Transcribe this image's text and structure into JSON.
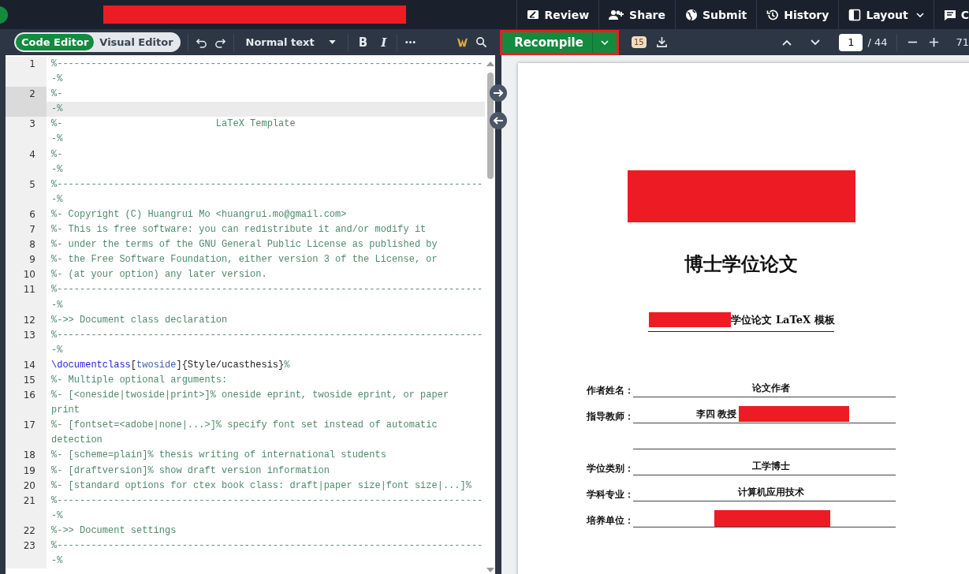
{
  "top_nav": [
    {
      "kind": "review",
      "label": "Review",
      "dropdown": false
    },
    {
      "kind": "share",
      "label": "Share",
      "dropdown": false
    },
    {
      "kind": "submit",
      "label": "Submit",
      "dropdown": false
    },
    {
      "kind": "history",
      "label": "History",
      "dropdown": false
    },
    {
      "kind": "layout",
      "label": "Layout",
      "dropdown": true
    },
    {
      "kind": "chat",
      "label": "C",
      "dropdown": false
    }
  ],
  "editor_modes": [
    {
      "label": "Code Editor",
      "selected": true
    },
    {
      "label": "Visual Editor",
      "selected": false
    }
  ],
  "style_dropdown": "Normal text",
  "format_buttons": [
    {
      "kind": "bold",
      "label": "B"
    },
    {
      "kind": "italic",
      "label": "I"
    }
  ],
  "pdf_toolbar": {
    "recompile": "Recompile",
    "log_badge": "15",
    "page": "1",
    "total": "/ 44",
    "zoom": "71"
  },
  "editor_lines": [
    {
      "number": "1",
      "text": "%---------------------------------------------------------------------------",
      "continuation": "-%",
      "active": false
    },
    {
      "number": "2",
      "text": "%-",
      "continuation": "-%",
      "active": true
    },
    {
      "number": "3",
      "text": "%-                           LaTeX Template",
      "continuation": "-%",
      "active": false
    },
    {
      "number": "4",
      "text": "%-",
      "continuation": "-%",
      "active": false
    },
    {
      "number": "5",
      "text": "%---------------------------------------------------------------------------",
      "continuation": "-%",
      "active": false
    },
    {
      "number": "6",
      "text": "%- Copyright (C) Huangrui Mo <huangrui.mo@gmail.com>",
      "active": false
    },
    {
      "number": "7",
      "text": "%- This is free software: you can redistribute it and/or modify it",
      "active": false
    },
    {
      "number": "8",
      "text": "%- under the terms of the GNU General Public License as published by",
      "active": false
    },
    {
      "number": "9",
      "text": "%- the Free Software Foundation, either version 3 of the License, or",
      "active": false
    },
    {
      "number": "10",
      "text": "%- (at your option) any later version.",
      "active": false
    },
    {
      "number": "11",
      "text": "%---------------------------------------------------------------------------",
      "continuation": "-%",
      "active": false
    },
    {
      "number": "12",
      "text": "%->> Document class declaration",
      "active": false
    },
    {
      "number": "13",
      "text": "%---------------------------------------------------------------------------",
      "continuation": "-%",
      "active": false
    },
    {
      "number": "14",
      "segments": [
        {
          "kind": "command",
          "text": "\\documentclass"
        },
        {
          "kind": "plain",
          "text": "["
        },
        {
          "kind": "option",
          "text": "twoside"
        },
        {
          "kind": "plain",
          "text": "]{Style/ucasthesis}"
        },
        {
          "kind": "comment",
          "text": "%"
        }
      ],
      "active": false
    },
    {
      "number": "15",
      "text": "%- Multiple optional arguments:",
      "active": false
    },
    {
      "number": "16",
      "text": "%- [<oneside|twoside|print>]% oneside eprint, twoside eprint, or paper",
      "continuation": "print",
      "active": false
    },
    {
      "number": "17",
      "text": "%- [fontset=<adobe|none|...>]% specify font set instead of automatic",
      "continuation": "detection",
      "active": false
    },
    {
      "number": "18",
      "text": "%- [scheme=plain]% thesis writing of international students",
      "active": false
    },
    {
      "number": "19",
      "text": "%- [draftversion]% show draft version information",
      "active": false
    },
    {
      "number": "20",
      "text": "%- [standard options for ctex book class: draft|paper size|font size|...]%",
      "active": false
    },
    {
      "number": "21",
      "text": "%---------------------------------------------------------------------------",
      "continuation": "-%",
      "active": false
    },
    {
      "number": "22",
      "text": "%->> Document settings",
      "active": false
    },
    {
      "number": "23",
      "text": "%---------------------------------------------------------------------------",
      "continuation": "-%",
      "active": false
    }
  ],
  "pdf_page": {
    "title": "博士学位论文",
    "subtitle": "学位论文 LaTeX 模板",
    "form_rows": [
      {
        "kind": "field",
        "label": "作者姓名：",
        "value": "论文作者",
        "redacted": false
      },
      {
        "kind": "field",
        "label": "指导教师：",
        "value": "李四 教授",
        "redacted": true
      },
      {
        "kind": "blank",
        "redacted": false
      },
      {
        "kind": "field",
        "label": "学位类别：",
        "value": "工学博士",
        "redacted": false
      },
      {
        "kind": "field",
        "label": "学科专业：",
        "value": "计算机应用技术",
        "redacted": false
      },
      {
        "kind": "field",
        "label": "培养单位：",
        "redacted": true
      }
    ]
  }
}
